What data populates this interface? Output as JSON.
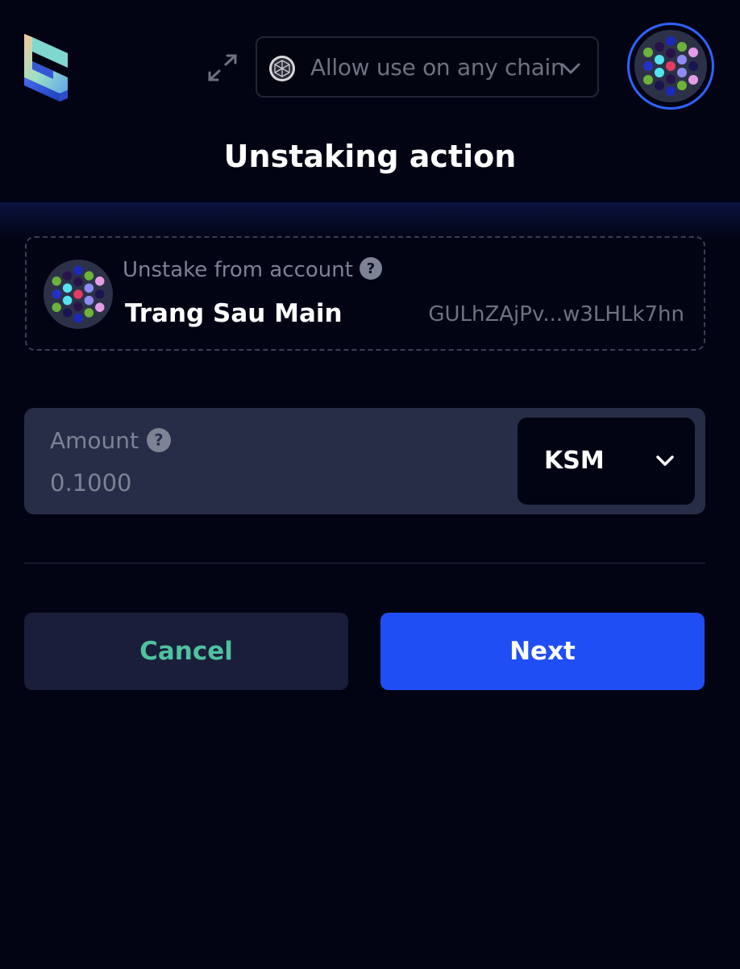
{
  "header": {
    "chain_selector": {
      "label": "Allow use on any chain"
    }
  },
  "page": {
    "title": "Unstaking action"
  },
  "account": {
    "label": "Unstake from account",
    "name": "Trang Sau Main",
    "address": "GULhZAjPv...w3LHLk7hn"
  },
  "amount": {
    "label": "Amount",
    "value": "0.1000",
    "token": "KSM"
  },
  "actions": {
    "cancel_label": "Cancel",
    "next_label": "Next"
  },
  "colors": {
    "background": "#020413",
    "primary": "#1f4ef5",
    "cancel_text": "#4ec29f",
    "input_bg": "#272d46",
    "muted_text": "#7d8295"
  },
  "icons": [
    "app-logo-icon",
    "expand-icon",
    "chain-network-icon",
    "chevron-down-icon",
    "help-icon",
    "account-identicon"
  ]
}
